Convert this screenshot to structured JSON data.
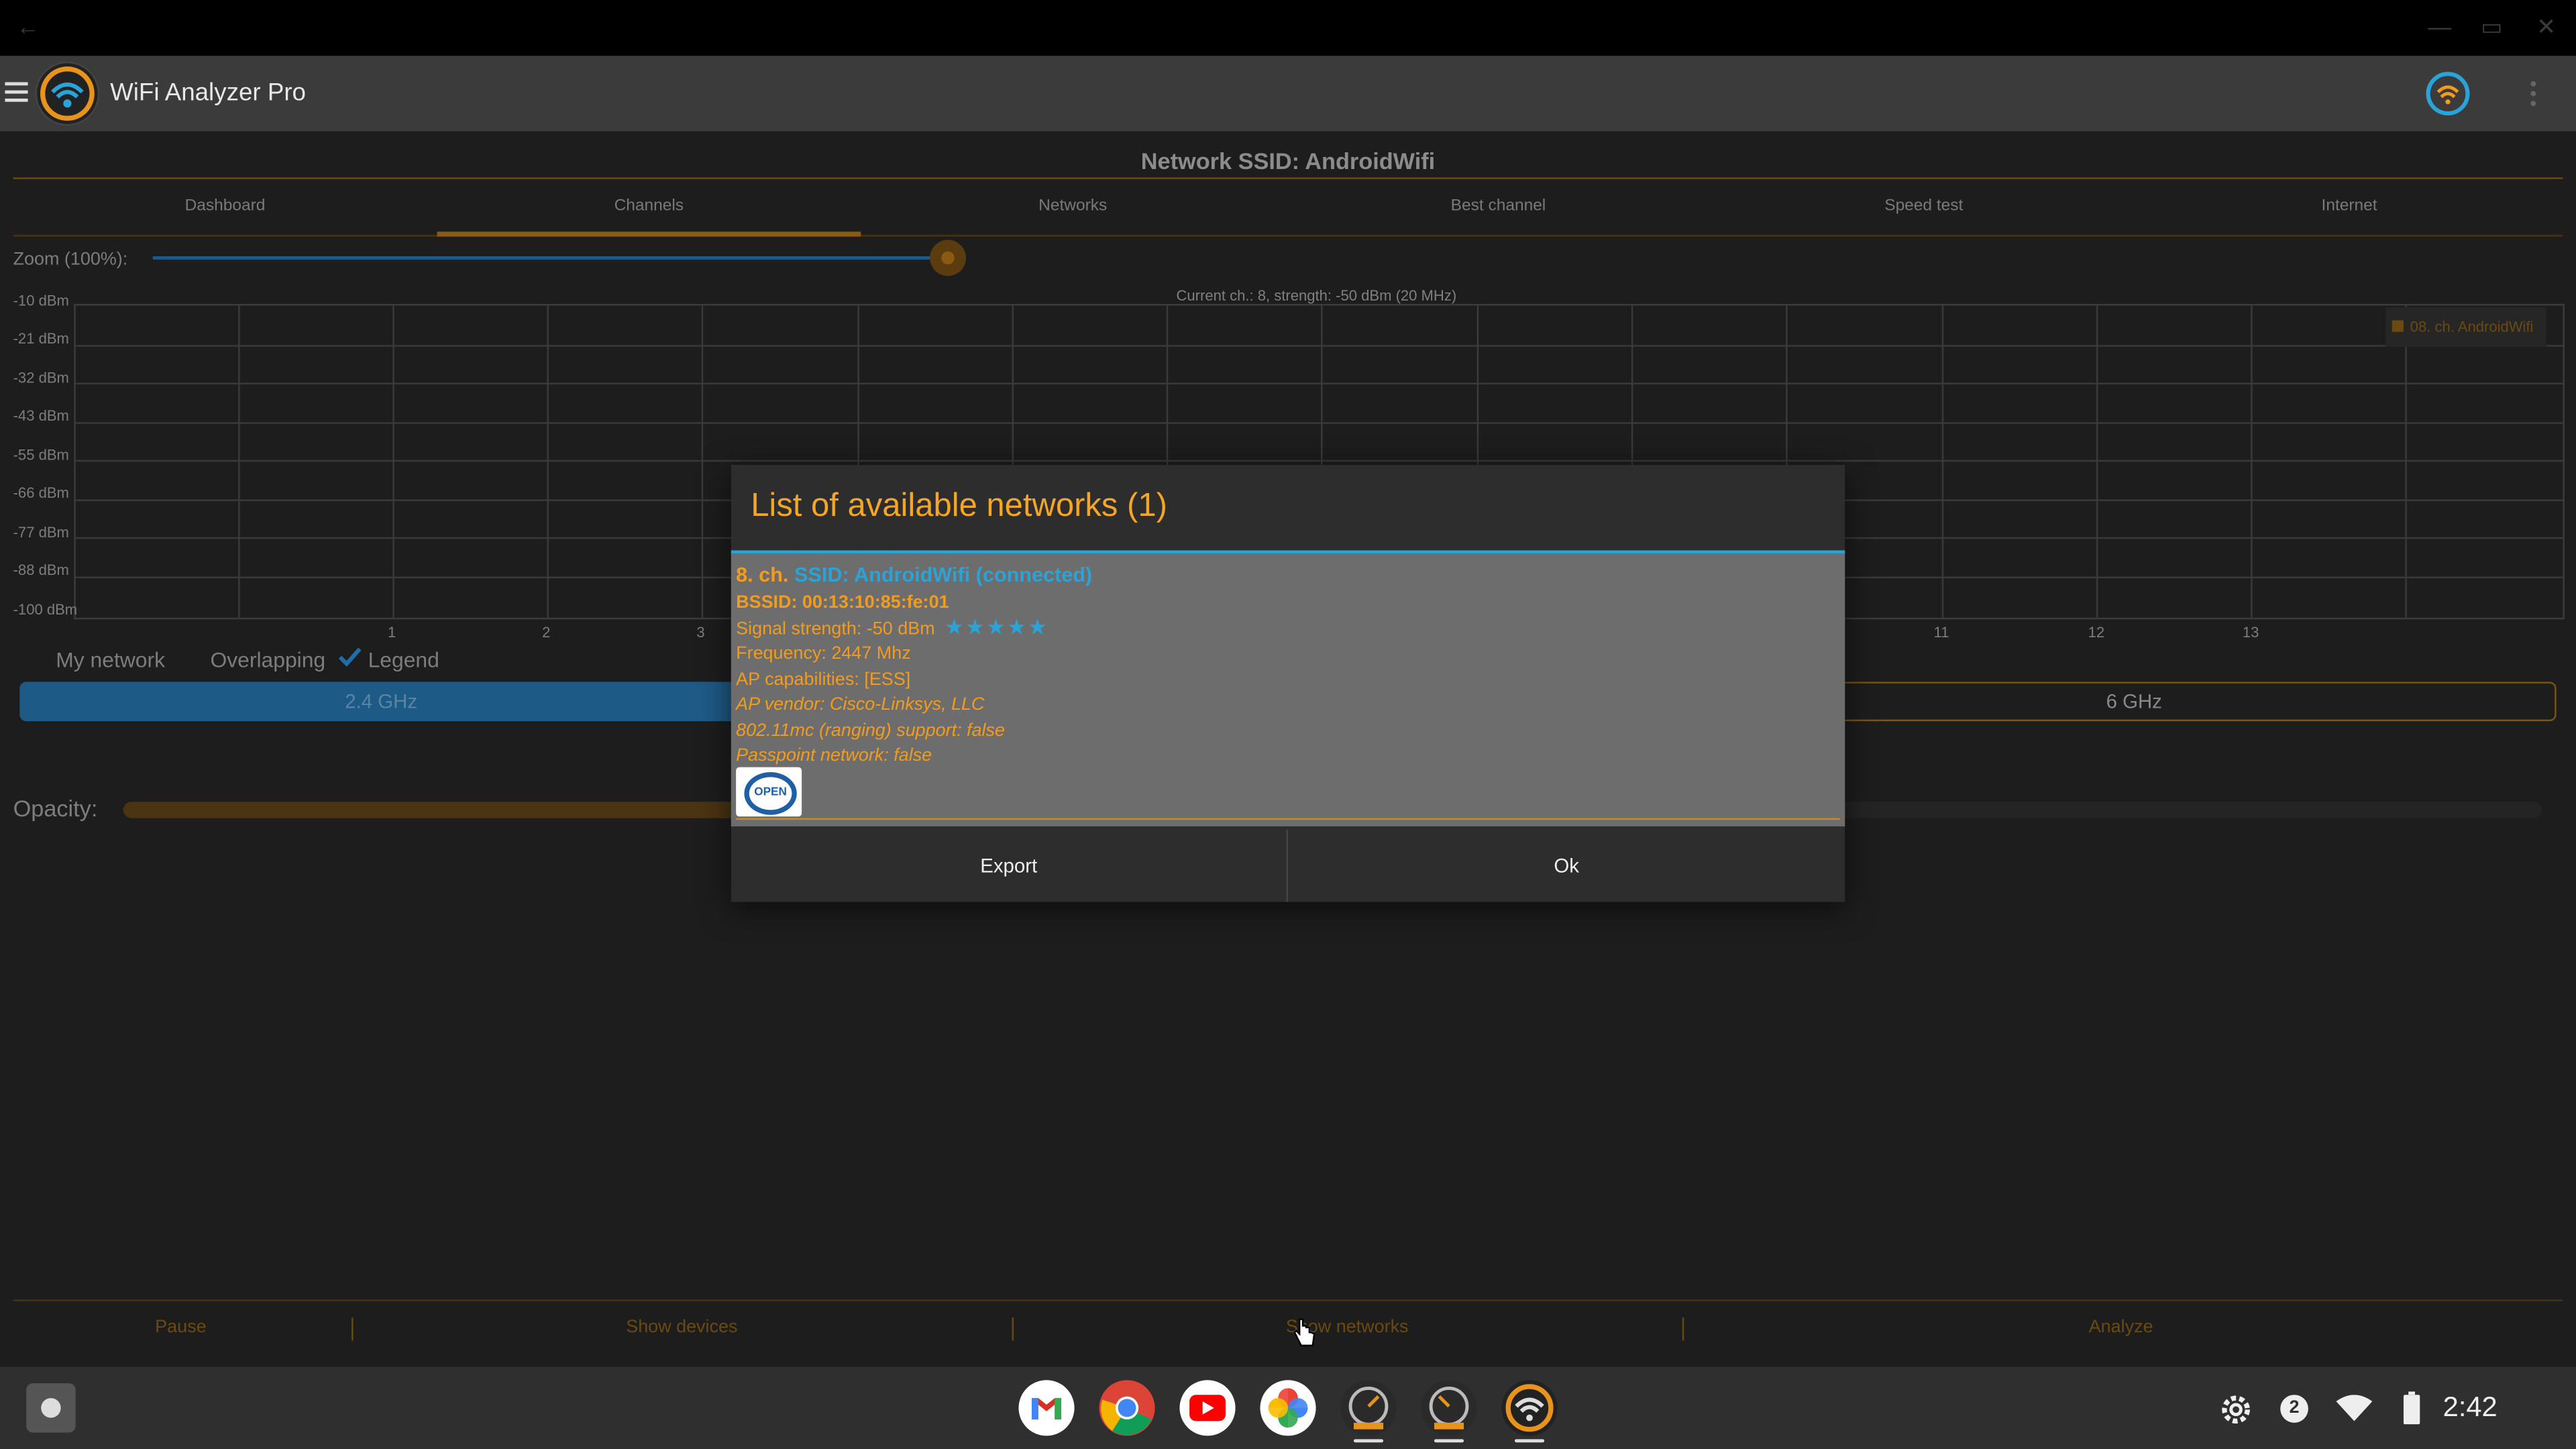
{
  "window": {
    "back_label": "←",
    "min_label": "—",
    "max_label": "▭",
    "close_label": "✕"
  },
  "appbar": {
    "title": "WiFi Analyzer Pro"
  },
  "header": {
    "ssid_title": "Network SSID: AndroidWifi"
  },
  "tabs": [
    {
      "label": "Dashboard"
    },
    {
      "label": "Channels",
      "selected": true
    },
    {
      "label": "Networks"
    },
    {
      "label": "Best channel"
    },
    {
      "label": "Speed test"
    },
    {
      "label": "Internet"
    }
  ],
  "zoom": {
    "label": "Zoom (100%):",
    "value_percent": 100
  },
  "chart": {
    "current_label": "Current ch.: 8, strength: -50 dBm (20 MHz)",
    "y_labels": [
      "-10 dBm",
      "-21 dBm",
      "-32 dBm",
      "-43 dBm",
      "-55 dBm",
      "-66 dBm",
      "-77 dBm",
      "-88 dBm",
      "-100 dBm"
    ],
    "x_labels_left": [
      "1",
      "2",
      "3"
    ],
    "x_labels_right": [
      "11",
      "12",
      "13"
    ],
    "legend_item": "08. ch. AndroidWifi"
  },
  "filters": {
    "my_network": "My network",
    "overlapping": "Overlapping",
    "legend": "Legend"
  },
  "bands": {
    "b24": "2.4 GHz",
    "b6": "6 GHz"
  },
  "opacity": {
    "label": "Opacity:"
  },
  "bottom": {
    "pause": "Pause",
    "show_devices": "Show devices",
    "show_networks": "Show networks",
    "analyze": "Analyze"
  },
  "dialog": {
    "title": "List of available networks (1)",
    "network": {
      "channel": "8. ch.",
      "ssid": "SSID: AndroidWifi (connected)",
      "bssid": "BSSID: 00:13:10:85:fe:01",
      "signal": "Signal strength: -50 dBm",
      "stars": "★★★★★",
      "frequency": "Frequency: 2447 Mhz",
      "capabilities": "AP capabilities: [ESS]",
      "vendor": "AP vendor: Cisco-Linksys, LLC",
      "ranging": "802.11mc (ranging) support: false",
      "passpoint": "Passpoint network: false",
      "badge": "OPEN"
    },
    "export_label": "Export",
    "ok_label": "Ok"
  },
  "shelf": {
    "notification_count": "2",
    "time": "2:42"
  },
  "colors": {
    "accent": "#f5a623",
    "blue": "#2aa3d8",
    "dark": "#1d1d1d"
  }
}
